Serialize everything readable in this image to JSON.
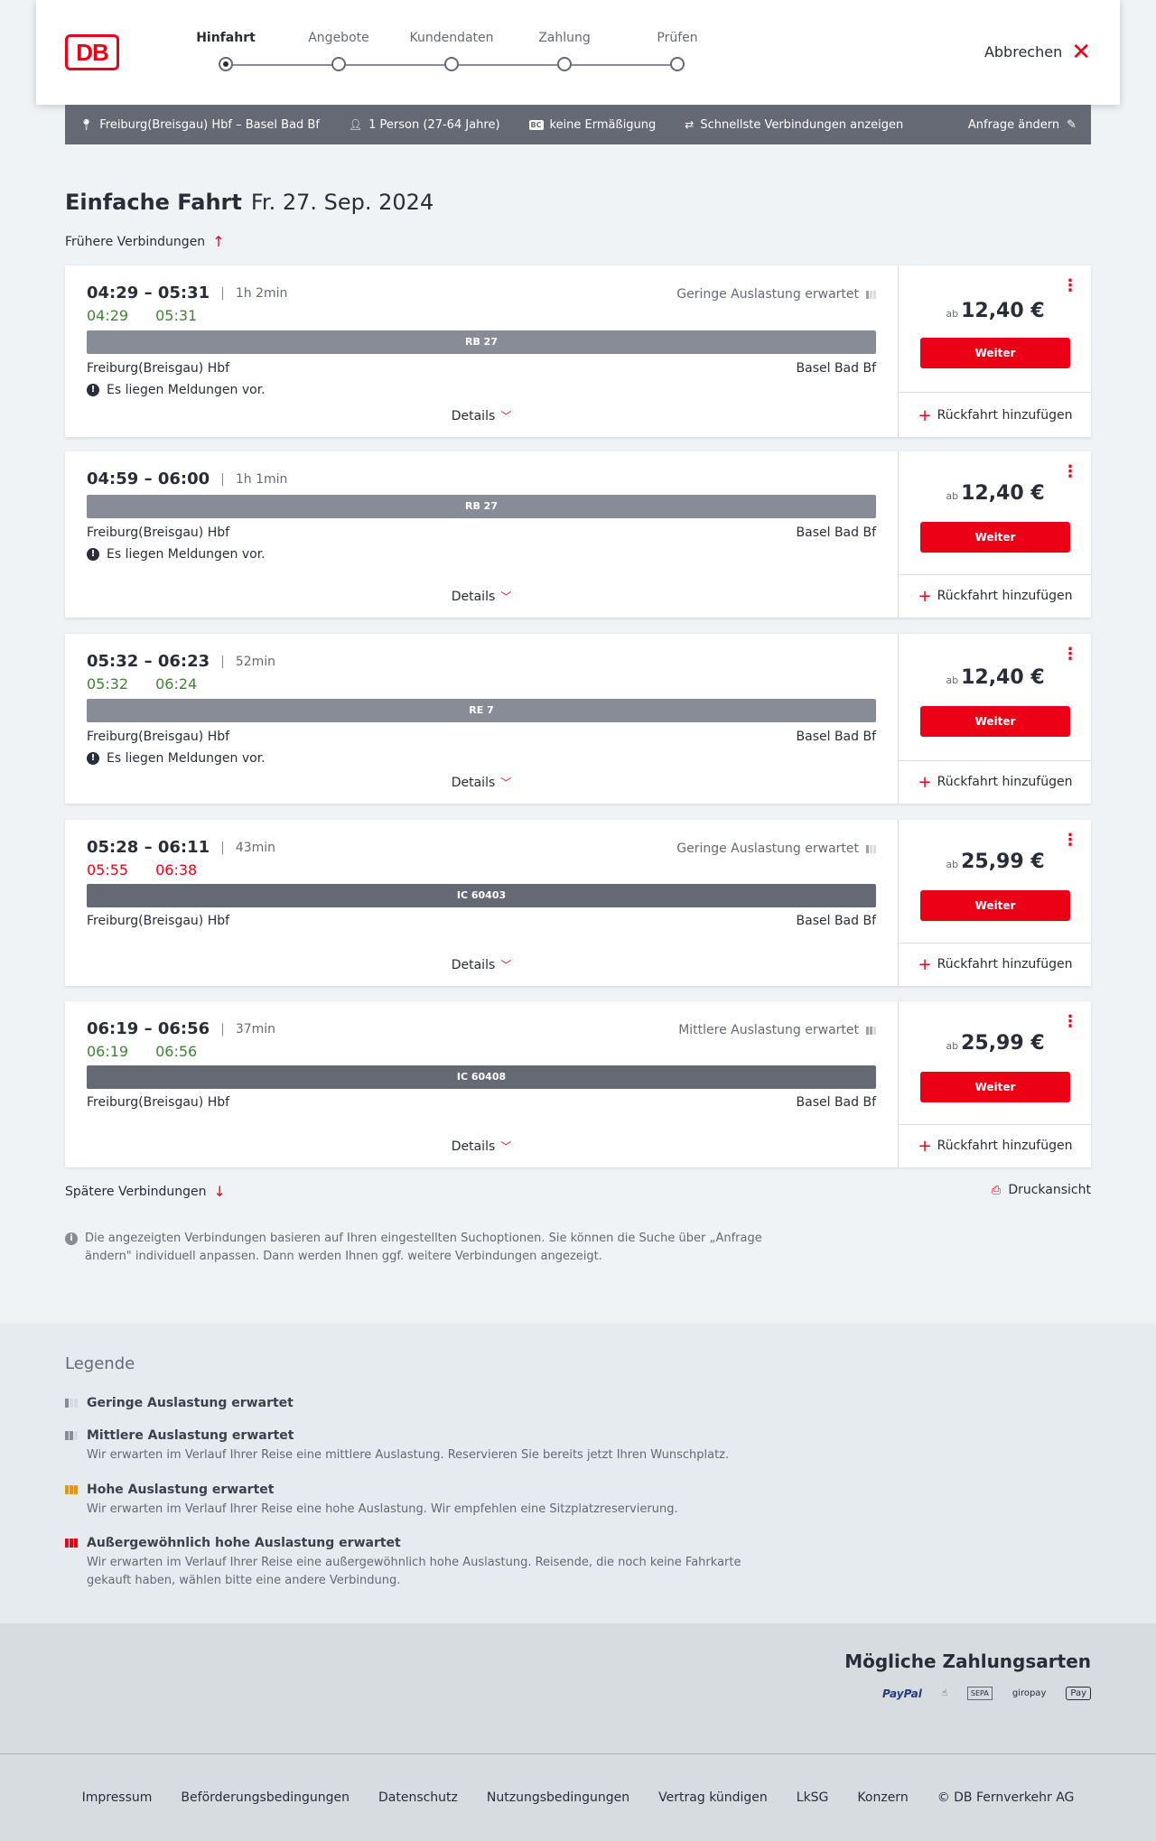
{
  "header": {
    "logo": "DB",
    "steps": [
      {
        "label": "Hinfahrt",
        "active": true
      },
      {
        "label": "Angebote",
        "active": false
      },
      {
        "label": "Kundendaten",
        "active": false
      },
      {
        "label": "Zahlung",
        "active": false
      },
      {
        "label": "Prüfen",
        "active": false
      }
    ],
    "cancel_label": "Abbrechen"
  },
  "searchbar": {
    "route": "Freiburg(Breisgau) Hbf – Basel Bad Bf",
    "passengers": "1 Person (27-64 Jahre)",
    "discount_badge": "BC",
    "discount": "keine Ermäßigung",
    "fastest": "Schnellste Verbindungen anzeigen",
    "change_label": "Anfrage ändern"
  },
  "title": {
    "trip_type": "Einfache Fahrt",
    "date": "Fr. 27. Sep. 2024"
  },
  "earlier_label": "Frühere Verbindungen",
  "later_label": "Spätere Verbindungen",
  "print_label": "Druckansicht",
  "connections": [
    {
      "time": "04:29 – 05:31",
      "duration": "1h 2min",
      "rt_dep": "04:29",
      "rt_arr": "05:31",
      "rt_color": "green",
      "occupancy": "Geringe Auslastung erwartet",
      "occ_level": 1,
      "train": "RB 27",
      "train_dark": false,
      "from": "Freiburg(Breisgau) Hbf",
      "to": "Basel Bad Bf",
      "notice": "Es liegen Meldungen vor.",
      "details": "Details",
      "ab": "ab",
      "price": "12,40 €",
      "button": "Weiter",
      "return": "Rückfahrt hinzufügen"
    },
    {
      "time": "04:59 – 06:00",
      "duration": "1h 1min",
      "rt_dep": "",
      "rt_arr": "",
      "rt_color": "",
      "occupancy": "",
      "occ_level": 0,
      "train": "RB 27",
      "train_dark": false,
      "from": "Freiburg(Breisgau) Hbf",
      "to": "Basel Bad Bf",
      "notice": "Es liegen Meldungen vor.",
      "details": "Details",
      "ab": "ab",
      "price": "12,40 €",
      "button": "Weiter",
      "return": "Rückfahrt hinzufügen"
    },
    {
      "time": "05:32 – 06:23",
      "duration": "52min",
      "rt_dep": "05:32",
      "rt_arr": "06:24",
      "rt_color": "green",
      "occupancy": "",
      "occ_level": 0,
      "train": "RE 7",
      "train_dark": false,
      "from": "Freiburg(Breisgau) Hbf",
      "to": "Basel Bad Bf",
      "notice": "Es liegen Meldungen vor.",
      "details": "Details",
      "ab": "ab",
      "price": "12,40 €",
      "button": "Weiter",
      "return": "Rückfahrt hinzufügen"
    },
    {
      "time": "05:28 – 06:11",
      "duration": "43min",
      "rt_dep": "05:55",
      "rt_arr": "06:38",
      "rt_color": "red",
      "occupancy": "Geringe Auslastung erwartet",
      "occ_level": 1,
      "train": "IC 60403",
      "train_dark": true,
      "from": "Freiburg(Breisgau) Hbf",
      "to": "Basel Bad Bf",
      "notice": "",
      "details": "Details",
      "ab": "ab",
      "price": "25,99 €",
      "button": "Weiter",
      "return": "Rückfahrt hinzufügen"
    },
    {
      "time": "06:19 – 06:56",
      "duration": "37min",
      "rt_dep": "06:19",
      "rt_arr": "06:56",
      "rt_color": "green",
      "occupancy": "Mittlere Auslastung erwartet",
      "occ_level": 2,
      "train": "IC 60408",
      "train_dark": true,
      "from": "Freiburg(Breisgau) Hbf",
      "to": "Basel Bad Bf",
      "notice": "",
      "details": "Details",
      "ab": "ab",
      "price": "25,99 €",
      "button": "Weiter",
      "return": "Rückfahrt hinzufügen"
    }
  ],
  "info_text": "Die angezeigten Verbindungen basieren auf Ihren eingestellten Suchoptionen. Sie können die Suche über „Anfrage ändern\" individuell anpassen. Dann werden Ihnen ggf. weitere Verbindungen angezeigt.",
  "legend": {
    "title": "Legende",
    "items": [
      {
        "title": "Geringe Auslastung erwartet",
        "desc": "",
        "icon": "occupancy-low-icon"
      },
      {
        "title": "Mittlere Auslastung erwartet",
        "desc": "Wir erwarten im Verlauf Ihrer Reise eine mittlere Auslastung. Reservieren Sie bereits jetzt Ihren Wunschplatz.",
        "icon": "occupancy-medium-icon"
      },
      {
        "title": "Hohe Auslastung erwartet",
        "desc": "Wir erwarten im Verlauf Ihrer Reise eine hohe Auslastung. Wir empfehlen eine Sitzplatzreservierung.",
        "icon": "occupancy-high-icon"
      },
      {
        "title": "Außergewöhnlich hohe Auslastung erwartet",
        "desc": "Wir erwarten im Verlauf Ihrer Reise eine außergewöhnlich hohe Auslastung. Reisende, die noch keine Fahrkarte gekauft haben, wählen bitte eine andere Verbindung.",
        "icon": "occupancy-exceptional-icon"
      }
    ]
  },
  "payment": {
    "title": "Mögliche Zahlungsarten",
    "methods": [
      "PayPal",
      "SEPA",
      "giropay",
      "Pay"
    ]
  },
  "footer": {
    "links": [
      "Impressum",
      "Beförderungsbedingungen",
      "Datenschutz",
      "Nutzungsbedingungen",
      "Vertrag kündigen",
      "LkSG",
      "Konzern",
      "© DB Fernverkehr AG"
    ]
  },
  "colors": {
    "accent": "#ec0016",
    "on_time": "#408335",
    "bar_grey": "#646973"
  }
}
